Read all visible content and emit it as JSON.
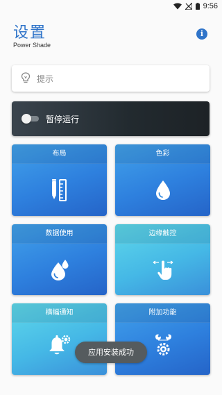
{
  "status_bar": {
    "time": "9:56"
  },
  "header": {
    "title": "设置",
    "subtitle": "Power Shade"
  },
  "tip": {
    "label": "提示"
  },
  "pause": {
    "label": "暂停运行",
    "enabled": false
  },
  "tiles": [
    {
      "label": "布局",
      "icon": "ruler-pencil-icon"
    },
    {
      "label": "色彩",
      "icon": "water-drop-icon"
    },
    {
      "label": "数据使用",
      "icon": "water-drops-icon"
    },
    {
      "label": "边缘触控",
      "icon": "hand-swipe-icon"
    },
    {
      "label": "横幅通知",
      "icon": "bell-gear-icon"
    },
    {
      "label": "附加功能",
      "icon": "wrench-gear-icon"
    }
  ],
  "toast": {
    "message": "应用安装成功"
  },
  "colors": {
    "accent": "#2f74c9",
    "tile_blue": "#2e80de",
    "tile_cyan": "#45b8e6",
    "dark_card": "#222a2f"
  }
}
